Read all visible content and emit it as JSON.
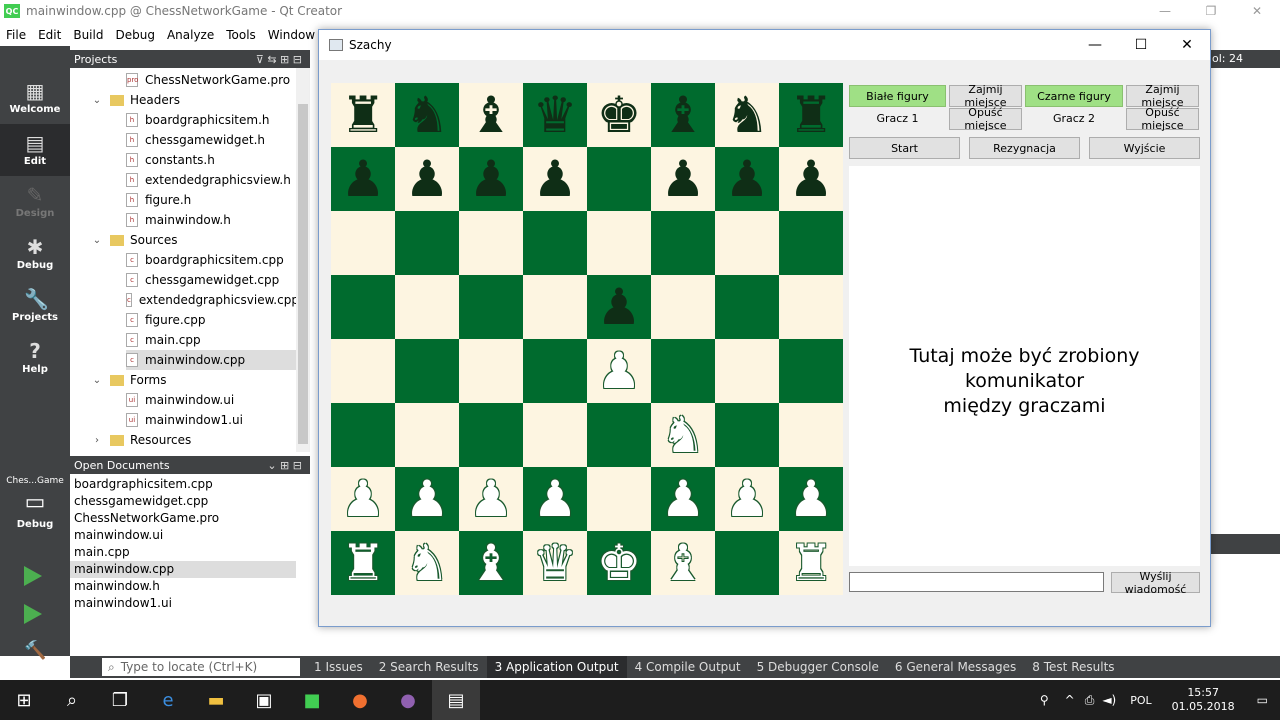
{
  "qt": {
    "title": "mainwindow.cpp @ ChessNetworkGame - Qt Creator",
    "logo": "QC",
    "menu": [
      "File",
      "Edit",
      "Build",
      "Debug",
      "Analyze",
      "Tools",
      "Window"
    ],
    "modes": [
      {
        "label": "Welcome",
        "icon": "▦"
      },
      {
        "label": "Edit",
        "icon": "▤"
      },
      {
        "label": "Design",
        "icon": "✎"
      },
      {
        "label": "Debug",
        "icon": "✱"
      },
      {
        "label": "Projects",
        "icon": "🔧"
      },
      {
        "label": "Help",
        "icon": "?"
      }
    ],
    "projects_header": "Projects",
    "tree": [
      {
        "label": "ChessNetworkGame.pro",
        "indent": 2,
        "kind": "file",
        "ic": "pro"
      },
      {
        "label": "Headers",
        "indent": 1,
        "kind": "folder",
        "arrow": "⌄"
      },
      {
        "label": "boardgraphicsitem.h",
        "indent": 2,
        "kind": "file",
        "ic": "h"
      },
      {
        "label": "chessgamewidget.h",
        "indent": 2,
        "kind": "file",
        "ic": "h"
      },
      {
        "label": "constants.h",
        "indent": 2,
        "kind": "file",
        "ic": "h"
      },
      {
        "label": "extendedgraphicsview.h",
        "indent": 2,
        "kind": "file",
        "ic": "h"
      },
      {
        "label": "figure.h",
        "indent": 2,
        "kind": "file",
        "ic": "h"
      },
      {
        "label": "mainwindow.h",
        "indent": 2,
        "kind": "file",
        "ic": "h"
      },
      {
        "label": "Sources",
        "indent": 1,
        "kind": "folder",
        "arrow": "⌄"
      },
      {
        "label": "boardgraphicsitem.cpp",
        "indent": 2,
        "kind": "file",
        "ic": "c"
      },
      {
        "label": "chessgamewidget.cpp",
        "indent": 2,
        "kind": "file",
        "ic": "c"
      },
      {
        "label": "extendedgraphicsview.cpp",
        "indent": 2,
        "kind": "file",
        "ic": "c"
      },
      {
        "label": "figure.cpp",
        "indent": 2,
        "kind": "file",
        "ic": "c"
      },
      {
        "label": "main.cpp",
        "indent": 2,
        "kind": "file",
        "ic": "c"
      },
      {
        "label": "mainwindow.cpp",
        "indent": 2,
        "kind": "file",
        "ic": "c",
        "selected": true
      },
      {
        "label": "Forms",
        "indent": 1,
        "kind": "folder",
        "arrow": "⌄"
      },
      {
        "label": "mainwindow.ui",
        "indent": 2,
        "kind": "file",
        "ic": "ui"
      },
      {
        "label": "mainwindow1.ui",
        "indent": 2,
        "kind": "file",
        "ic": "ui"
      },
      {
        "label": "Resources",
        "indent": 1,
        "kind": "folder",
        "arrow": "›"
      }
    ],
    "open_docs_header": "Open Documents",
    "open_docs": [
      {
        "label": "boardgraphicsitem.cpp"
      },
      {
        "label": "chessgamewidget.cpp"
      },
      {
        "label": "ChessNetworkGame.pro"
      },
      {
        "label": "mainwindow.ui"
      },
      {
        "label": "main.cpp"
      },
      {
        "label": "mainwindow.cpp",
        "selected": true
      },
      {
        "label": "mainwindow.h"
      },
      {
        "label": "mainwindow1.ui"
      }
    ],
    "kit_name": "Ches...Game",
    "kit_mode": "Debug",
    "editor_status": "ol: 24",
    "locate_placeholder": "Type to locate (Ctrl+K)",
    "output_tabs": [
      {
        "label": "1  Issues"
      },
      {
        "label": "2  Search Results"
      },
      {
        "label": "3  Application Output",
        "active": true
      },
      {
        "label": "4  Compile Output"
      },
      {
        "label": "5  Debugger Console"
      },
      {
        "label": "6  General Messages"
      },
      {
        "label": "8  Test Results"
      }
    ]
  },
  "chess": {
    "title": "Szachy",
    "white_btn": "Białe figury",
    "take_seat_1": "Zajmij miejsce",
    "black_btn": "Czarne figury",
    "take_seat_2": "Zajmij miejsce",
    "player1": "Gracz 1",
    "leave_seat_1": "Opuść miejsce",
    "player2": "Gracz 2",
    "leave_seat_2": "Opuść miejsce",
    "start": "Start",
    "resign": "Rezygnacja",
    "exit": "Wyjście",
    "chat_placeholder_line1": "Tutaj może być zrobiony komunikator",
    "chat_placeholder_line2": "między graczami",
    "send": "Wyślij wiadomość",
    "board": [
      "rnbqkbnr",
      "pppp.ppp",
      "........",
      "....p...",
      "....P...",
      ".....N..",
      "PPPP.PPP",
      "RNBQKB.R"
    ],
    "light_color": "#fdf5e1",
    "dark_color": "#006b2e"
  },
  "taskbar": {
    "time": "15:57",
    "date": "01.05.2018",
    "lang": "POL"
  }
}
